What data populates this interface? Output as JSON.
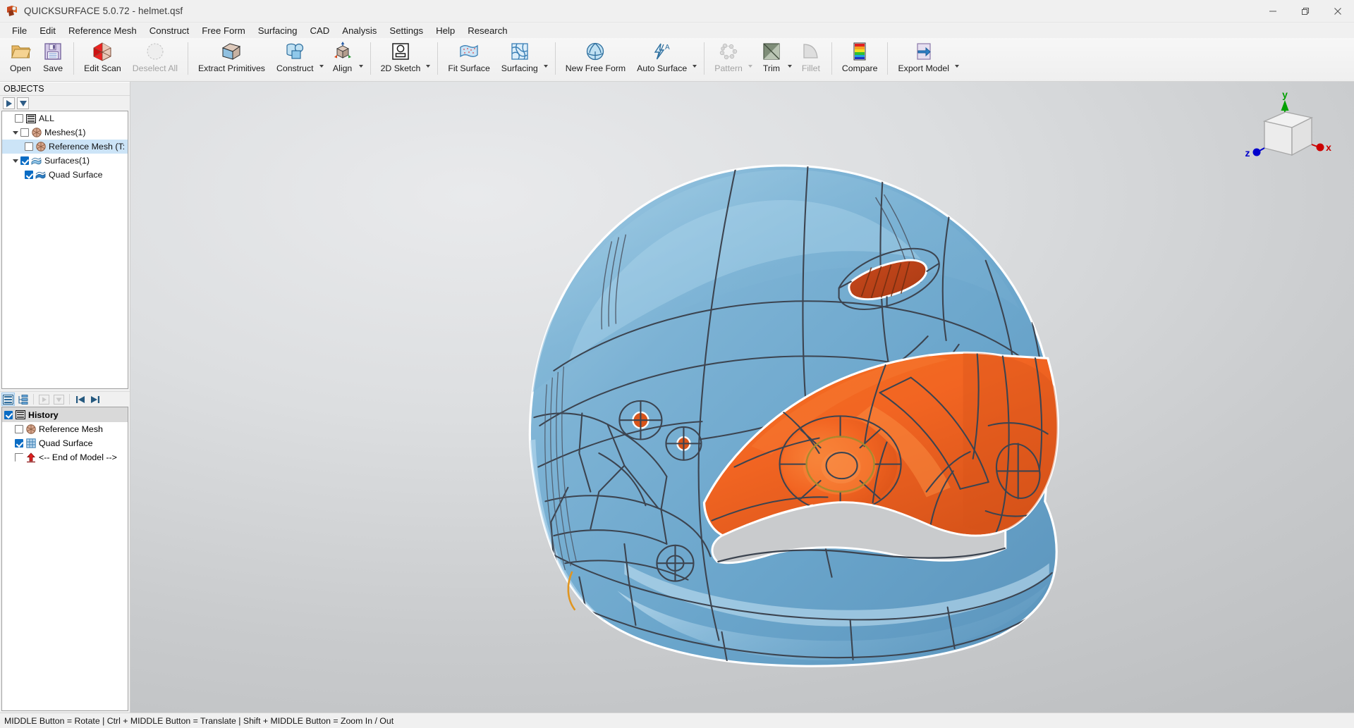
{
  "window": {
    "title": "QUICKSURFACE 5.0.72 - helmet.qsf",
    "app_icon_name": "quicksurface-logo-icon",
    "minimize": "—",
    "maximize": "❐",
    "close": "✕"
  },
  "menubar": {
    "items": [
      {
        "label": "File"
      },
      {
        "label": "Edit"
      },
      {
        "label": "Reference Mesh"
      },
      {
        "label": "Construct"
      },
      {
        "label": "Free Form"
      },
      {
        "label": "Surfacing"
      },
      {
        "label": "CAD"
      },
      {
        "label": "Analysis"
      },
      {
        "label": "Settings"
      },
      {
        "label": "Help"
      },
      {
        "label": "Research"
      }
    ]
  },
  "toolbar": {
    "groups": [
      {
        "buttons": [
          {
            "label": "Open",
            "icon": "folder-open-icon",
            "enabled": true,
            "dropdown": false
          },
          {
            "label": "Save",
            "icon": "floppy-disk-icon",
            "enabled": true,
            "dropdown": false
          }
        ]
      },
      {
        "buttons": [
          {
            "label": "Edit Scan",
            "icon": "mesh-hexagon-icon",
            "enabled": true,
            "dropdown": false
          },
          {
            "label": "Deselect All",
            "icon": "deselect-circle-icon",
            "enabled": false,
            "dropdown": false
          }
        ]
      },
      {
        "buttons": [
          {
            "label": "Extract Primitives",
            "icon": "extract-primitives-box-icon",
            "enabled": true,
            "dropdown": false
          },
          {
            "label": "Construct",
            "icon": "construct-cylinder-box-icon",
            "enabled": true,
            "dropdown": true
          },
          {
            "label": "Align",
            "icon": "align-axes-cube-icon",
            "enabled": true,
            "dropdown": true
          }
        ]
      },
      {
        "buttons": [
          {
            "label": "2D Sketch",
            "icon": "sketch-rectangle-circle-icon",
            "enabled": true,
            "dropdown": true
          }
        ]
      },
      {
        "buttons": [
          {
            "label": "Fit Surface",
            "icon": "fit-surface-patch-icon",
            "enabled": true,
            "dropdown": false
          },
          {
            "label": "Surfacing",
            "icon": "surfacing-curves-icon",
            "enabled": true,
            "dropdown": true
          }
        ]
      },
      {
        "buttons": [
          {
            "label": "New Free Form",
            "icon": "free-form-sphere-icon",
            "enabled": true,
            "dropdown": false
          },
          {
            "label": "Auto Surface",
            "icon": "auto-surface-lightning-icon",
            "enabled": true,
            "dropdown": true
          }
        ]
      },
      {
        "buttons": [
          {
            "label": "Pattern",
            "icon": "pattern-nodes-icon",
            "enabled": false,
            "dropdown": true
          },
          {
            "label": "Trim",
            "icon": "trim-diagonal-icon",
            "enabled": true,
            "dropdown": true
          },
          {
            "label": "Fillet",
            "icon": "fillet-corner-icon",
            "enabled": false,
            "dropdown": false
          }
        ]
      },
      {
        "buttons": [
          {
            "label": "Compare",
            "icon": "compare-colormap-icon",
            "enabled": true,
            "dropdown": false
          }
        ]
      },
      {
        "buttons": [
          {
            "label": "Export Model",
            "icon": "export-arrow-icon",
            "enabled": true,
            "dropdown": true
          }
        ]
      }
    ]
  },
  "sidebar": {
    "objects_panel": {
      "title": "OBJECTS",
      "toolbar": [
        {
          "name": "expand-all-button",
          "icon": "triangle-right-icon"
        },
        {
          "name": "collapse-all-button",
          "icon": "triangle-down-icon"
        }
      ],
      "tree": [
        {
          "label": "ALL",
          "icon": "all-list-icon",
          "checked": false,
          "indent": 0,
          "expander": "none",
          "selected": false
        },
        {
          "label": "Meshes(1)",
          "icon": "mesh-icon",
          "checked": false,
          "indent": 1,
          "expander": "down",
          "selected": false
        },
        {
          "label": "Reference Mesh (T:",
          "icon": "mesh-icon",
          "checked": false,
          "indent": 2,
          "expander": "none",
          "selected": true
        },
        {
          "label": "Surfaces(1)",
          "icon": "surface-icon",
          "checked": true,
          "indent": 1,
          "expander": "down",
          "selected": false
        },
        {
          "label": "Quad Surface",
          "icon": "surface-icon",
          "checked": true,
          "indent": 2,
          "expander": "none",
          "selected": false
        }
      ]
    },
    "history_panel": {
      "toolbar": [
        {
          "name": "history-list-view-button",
          "icon": "list-lines-icon",
          "active": true
        },
        {
          "name": "history-tree-view-button",
          "icon": "tree-hierarchy-icon",
          "active": false
        },
        {
          "name": "history-play-button",
          "icon": "triangle-right-icon",
          "active": false,
          "disabled": true
        },
        {
          "name": "history-filter-button",
          "icon": "triangle-down-icon",
          "active": false,
          "disabled": true
        },
        {
          "name": "history-first-button",
          "icon": "skip-back-icon",
          "active": false
        },
        {
          "name": "history-last-button",
          "icon": "skip-forward-icon",
          "active": false
        }
      ],
      "header": {
        "label": "History",
        "checked": true,
        "icon": "all-list-icon"
      },
      "items": [
        {
          "label": "Reference Mesh",
          "icon": "mesh-icon",
          "checked": false
        },
        {
          "label": "Quad Surface",
          "icon": "quad-grid-icon",
          "checked": true
        },
        {
          "label": "<-- End of Model -->",
          "icon": "end-of-model-arrow-icon",
          "checked": false
        }
      ]
    }
  },
  "viewport": {
    "axis_widget": {
      "name": "view-orientation-cube",
      "x_label": "x",
      "y_label": "y",
      "z_label": "z",
      "x_color": "#cc0000",
      "y_color": "#00a000",
      "z_color": "#0000cc"
    },
    "model": {
      "name": "helmet-quad-surface-model",
      "outer_surface_color": "#6fa8cd",
      "inner_surface_color": "#f26522",
      "vent_color": "#c0441a",
      "edge_color": "#3c4450",
      "highlight_outline_color": "#ffffff"
    }
  },
  "statusbar": {
    "text": "MIDDLE Button = Rotate | Ctrl + MIDDLE Button = Translate | Shift + MIDDLE Button = Zoom In / Out"
  }
}
